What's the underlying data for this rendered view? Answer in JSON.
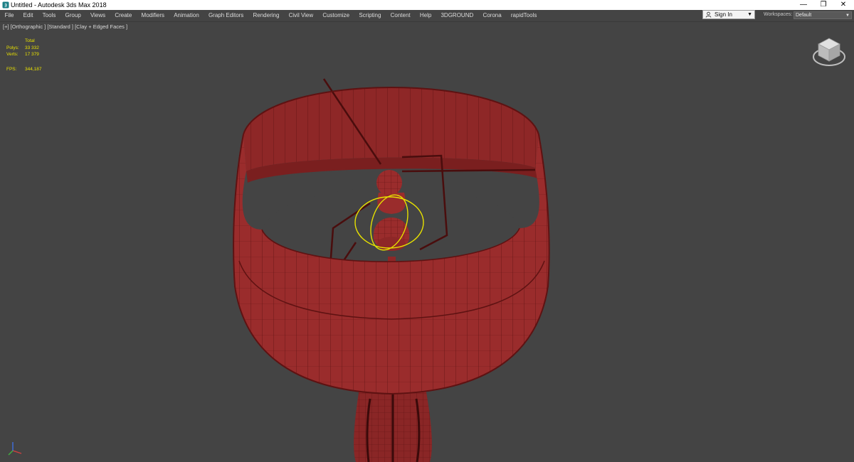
{
  "window": {
    "title": "Untitled - Autodesk 3ds Max 2018",
    "minimize_glyph": "—",
    "restore_glyph": "❐",
    "close_glyph": "✕"
  },
  "menu": {
    "items": [
      "File",
      "Edit",
      "Tools",
      "Group",
      "Views",
      "Create",
      "Modifiers",
      "Animation",
      "Graph Editors",
      "Rendering",
      "Civil View",
      "Customize",
      "Scripting",
      "Content",
      "Help",
      "3DGROUND",
      "Corona",
      "rapidTools"
    ]
  },
  "account": {
    "sign_in_label": "Sign In",
    "workspaces_label": "Workspaces:",
    "workspace_value": "Default"
  },
  "viewport": {
    "label": "[+] [Orthographic ] [Standard ] [Clay + Edged Faces ]",
    "stats": {
      "total_label": "Total",
      "polys_label": "Polys:",
      "polys_value": "33 332",
      "verts_label": "Verts:",
      "verts_value": "17 379",
      "fps_label": "FPS:",
      "fps_value": "344,187"
    }
  },
  "colors": {
    "viewport_bg": "#444444",
    "model_fill": "#9a2c2c",
    "model_edge": "#5e1212",
    "stats_text": "#e8e000",
    "selection": "#e6e000"
  },
  "icons": {
    "app": "3dsmax-icon",
    "user": "user-icon",
    "viewcube": "viewcube-icon",
    "axis": "axis-tripod-icon"
  }
}
